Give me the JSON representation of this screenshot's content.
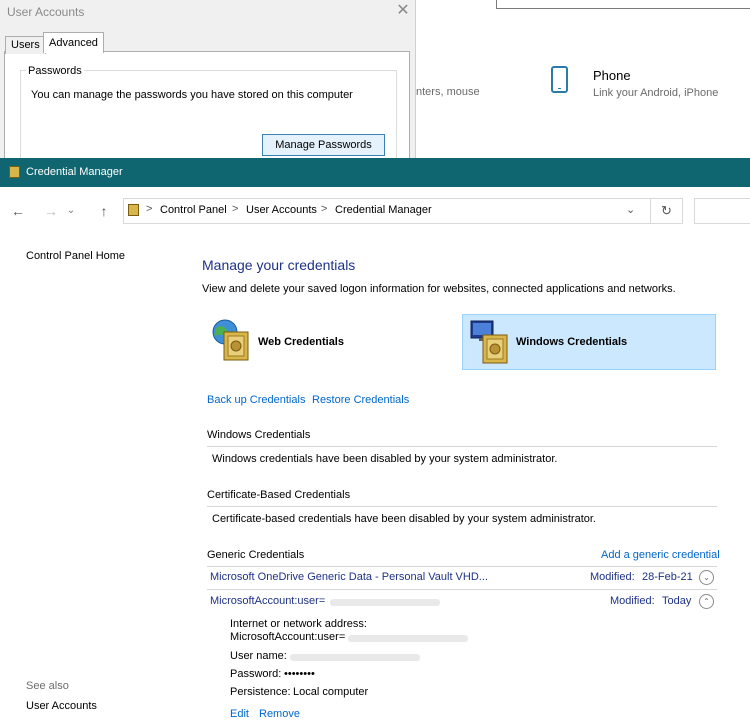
{
  "background": {
    "user_accounts": {
      "title": "User Accounts",
      "close_glyph": "✕",
      "tabs": [
        "Users",
        "Advanced"
      ],
      "passwords_group_label": "Passwords",
      "passwords_text": "You can manage the passwords you have stored on this computer",
      "manage_button": "Manage Passwords"
    },
    "settings": {
      "mouse_text": "nters, mouse",
      "phone_title": "Phone",
      "phone_subtitle": "Link your Android, iPhone"
    }
  },
  "window": {
    "title": "Credential Manager",
    "titlebar_color": "#0f6670"
  },
  "nav": {
    "back": "←",
    "forward": "→",
    "history": "⌄",
    "up": "↑",
    "breadcrumb_sep": ">",
    "breadcrumb": [
      "Control Panel",
      "User Accounts",
      "Credential Manager"
    ],
    "dropdown": "⌄",
    "refresh": "↻"
  },
  "sidebar": {
    "home_link": "Control Panel Home",
    "see_also": "See also",
    "see_also_links": [
      "User Accounts"
    ]
  },
  "main": {
    "heading": "Manage your credentials",
    "subtitle": "View and delete your saved logon information for websites, connected applications and networks.",
    "tiles": [
      {
        "label": "Web Credentials",
        "selected": false
      },
      {
        "label": "Windows Credentials",
        "selected": true
      }
    ],
    "links": {
      "backup": "Back up Credentials",
      "restore": "Restore Credentials"
    },
    "sections": {
      "windows": {
        "header": "Windows Credentials",
        "message": "Windows credentials have been disabled by your system administrator."
      },
      "certificate": {
        "header": "Certificate-Based Credentials",
        "message": "Certificate-based credentials have been disabled by your system administrator."
      },
      "generic": {
        "header": "Generic Credentials",
        "add_link": "Add a generic credential",
        "items": [
          {
            "name": "Microsoft OneDrive Generic Data - Personal Vault VHD...",
            "modified_label": "Modified:",
            "modified": "28-Feb-21",
            "expanded": false
          },
          {
            "name": "MicrosoftAccount:user=",
            "modified_label": "Modified:",
            "modified": "Today",
            "expanded": true
          }
        ],
        "details": {
          "address_label": "Internet or network address:",
          "address_value": "MicrosoftAccount:user=",
          "username_label": "User name:",
          "password_label": "Password:",
          "password_value": "••••••••",
          "persistence_label": "Persistence:",
          "persistence_value": "Local computer",
          "edit": "Edit",
          "remove": "Remove"
        }
      }
    }
  },
  "colors": {
    "link": "#0066cc",
    "heading": "#1e3287",
    "selected_tile": "#cce8ff"
  }
}
